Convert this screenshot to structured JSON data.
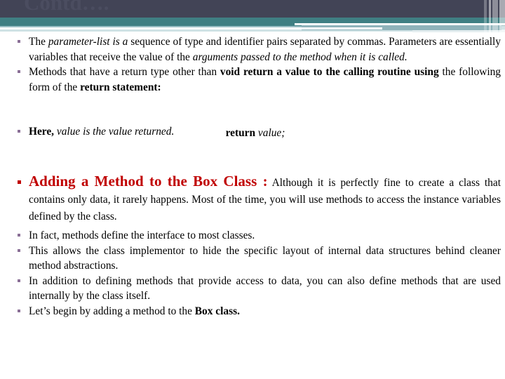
{
  "slide": {
    "title": "Contd….",
    "theme": {
      "navy": "#424456",
      "teal": "#3f7f83",
      "light_blue": "#9cc0c6",
      "accent_red": "#c00000",
      "bullet_purple": "#8a6f96",
      "body_text": "#000000",
      "background": "#ffffff"
    }
  },
  "content": {
    "bullet_1": {
      "seg_1": "The ",
      "seg_2_italic": "parameter-list is a",
      "seg_3": " sequence of type and identifier pairs separated by commas. Parameters are essentially variables that receive the value of the ",
      "seg_4_italic": "arguments passed to the method when it is called."
    },
    "bullet_2": {
      "seg_1": "Methods that have a return type other than ",
      "seg_2_bold": "void return a value to the calling routine using",
      "seg_3": " the following form of the ",
      "seg_4_bold": "return statement:"
    },
    "return_line": {
      "keyword_bold": "return",
      "value_italic": "value;"
    },
    "bullet_3": {
      "seg_1_bold": "Here,",
      "seg_2_italic": " value is the value returned."
    },
    "bullet_4": {
      "heading_red": "Adding a Method to the Box Class :",
      "body": " Although it is perfectly fine to create a class that contains only data, it rarely happens. Most of the time, you will use methods to access the instance variables defined by the class."
    },
    "bullet_5": {
      "text": "In fact, methods define the interface to most classes."
    },
    "bullet_6": {
      "text": "This allows the class implementor to hide the specific layout of internal data structures behind cleaner method abstractions."
    },
    "bullet_7": {
      "text": "In addition to defining methods that provide access to data, you can also define methods that are used internally by the class itself."
    },
    "bullet_8": {
      "seg_1": "Let’s begin by adding a method to the ",
      "seg_2_bold": "Box class."
    }
  }
}
